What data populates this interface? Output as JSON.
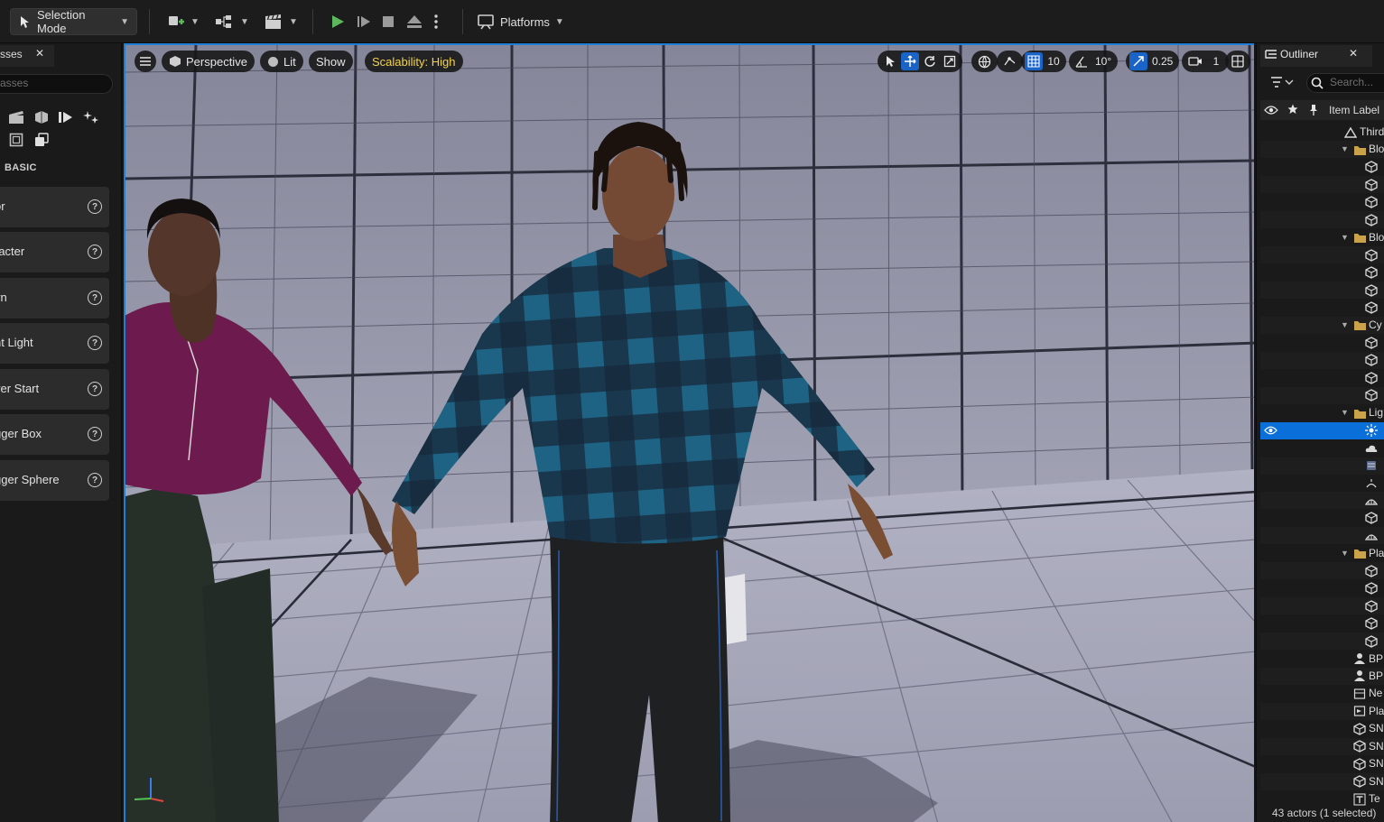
{
  "toolbar": {
    "mode_label": "Selection Mode",
    "platforms_label": "Platforms"
  },
  "left_panel": {
    "tab_label": "sses",
    "search_placeholder": "asses",
    "category_label": "BASIC",
    "items": [
      {
        "label": "or"
      },
      {
        "label": "racter"
      },
      {
        "label": "vn"
      },
      {
        "label": "nt Light"
      },
      {
        "label": "yer Start"
      },
      {
        "label": "gger Box"
      },
      {
        "label": "gger Sphere"
      }
    ],
    "help_glyph": "?"
  },
  "viewport": {
    "perspective_label": "Perspective",
    "lit_label": "Lit",
    "show_label": "Show",
    "scalability_label": "Scalability: High",
    "grid_snap": "10",
    "rotation_snap": "10°",
    "scale_snap": "0.25",
    "camera_speed": "1",
    "colors": {
      "accent": "#1f7ed6",
      "scalability_text": "#f3d34a",
      "play": "#5cb85c"
    }
  },
  "outliner": {
    "tab_label": "Outliner",
    "search_placeholder": "Search...",
    "column_label": "Item Label",
    "rows": [
      {
        "label": "Third",
        "icon": "level-icon"
      },
      {
        "label": "Blo",
        "icon": "folder-icon"
      },
      {
        "label": "",
        "icon": "mesh-icon"
      },
      {
        "label": "",
        "icon": "mesh-icon"
      },
      {
        "label": "",
        "icon": "mesh-icon"
      },
      {
        "label": "",
        "icon": "mesh-icon"
      },
      {
        "label": "Blo",
        "icon": "folder-icon"
      },
      {
        "label": "",
        "icon": "mesh-icon"
      },
      {
        "label": "",
        "icon": "mesh-icon"
      },
      {
        "label": "",
        "icon": "mesh-icon"
      },
      {
        "label": "",
        "icon": "mesh-icon"
      },
      {
        "label": "Cy",
        "icon": "folder-icon"
      },
      {
        "label": "",
        "icon": "mesh-icon"
      },
      {
        "label": "",
        "icon": "mesh-icon"
      },
      {
        "label": "",
        "icon": "mesh-icon"
      },
      {
        "label": "",
        "icon": "mesh-icon"
      },
      {
        "label": "Lig",
        "icon": "folder-icon"
      },
      {
        "label": "",
        "icon": "light-icon"
      },
      {
        "label": "",
        "icon": "cloud-icon"
      },
      {
        "label": "",
        "icon": "fog-icon"
      },
      {
        "label": "",
        "icon": "sun-icon"
      },
      {
        "label": "",
        "icon": "skylight-icon"
      },
      {
        "label": "",
        "icon": "mesh-icon"
      },
      {
        "label": "",
        "icon": "skylight-icon"
      },
      {
        "label": "Pla",
        "icon": "folder-icon"
      },
      {
        "label": "",
        "icon": "mesh-icon"
      },
      {
        "label": "",
        "icon": "mesh-icon"
      },
      {
        "label": "",
        "icon": "mesh-icon"
      },
      {
        "label": "",
        "icon": "mesh-icon"
      },
      {
        "label": "",
        "icon": "mesh-icon"
      },
      {
        "label": "BP",
        "icon": "pawn-icon"
      },
      {
        "label": "BP",
        "icon": "pawn-icon"
      },
      {
        "label": "Ne",
        "icon": "navmesh-icon"
      },
      {
        "label": "Pla",
        "icon": "player-start-icon"
      },
      {
        "label": "SN",
        "icon": "mesh-icon"
      },
      {
        "label": "SN",
        "icon": "mesh-icon"
      },
      {
        "label": "SN",
        "icon": "mesh-icon"
      },
      {
        "label": "SN",
        "icon": "mesh-icon"
      },
      {
        "label": "Te",
        "icon": "text-render-icon"
      }
    ],
    "footer": "43 actors (1 selected)"
  }
}
